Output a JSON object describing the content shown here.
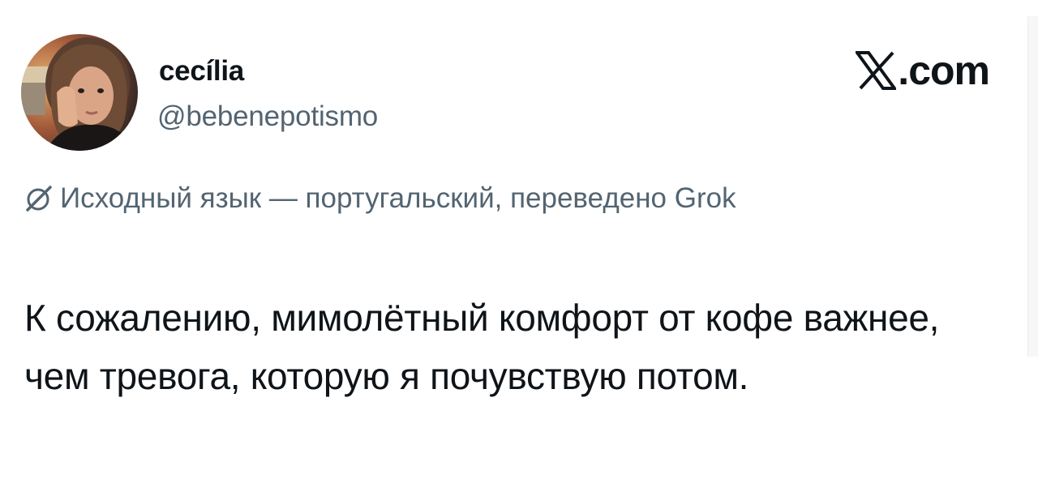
{
  "author": {
    "display_name": "cecília",
    "handle": "@bebenepotismo",
    "avatar_icon": "profile-photo"
  },
  "brand": {
    "logo_icon": "x-logo-icon",
    "suffix": ".com"
  },
  "translation_notice": {
    "icon": "grok-icon",
    "text": "Исходный язык — португальский, переведено Grok"
  },
  "tweet": {
    "text": "К сожалению, мимолётный комфорт от кофе важнее, чем тревога, которую я почувствую потом."
  },
  "colors": {
    "text_primary": "#0f1419",
    "text_secondary": "#536471",
    "background": "#ffffff"
  }
}
